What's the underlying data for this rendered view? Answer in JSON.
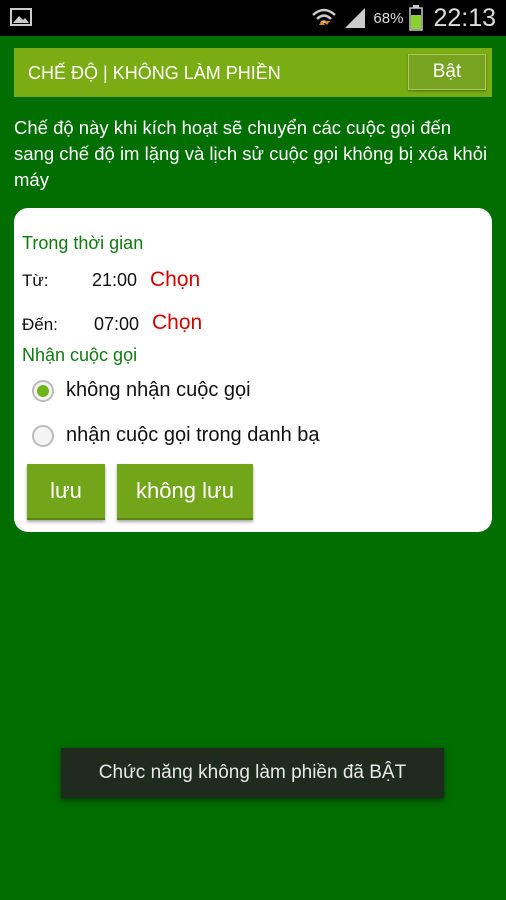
{
  "status_bar": {
    "battery_percent": "68%",
    "time": "22:13",
    "icons": [
      "image-icon",
      "wifi-icon",
      "signal-icon",
      "battery-icon"
    ]
  },
  "header": {
    "title": "CHẾ ĐỘ | KHÔNG LÀM PHIỀN",
    "toggle_label": "Bật"
  },
  "description": "Chế độ này khi kích hoạt sẽ chuyển các cuộc gọi đến sang chế độ im lặng và lịch sử cuộc gọi không bị xóa khỏi máy",
  "card": {
    "time_section_title": "Trong thời gian",
    "from": {
      "label": "Từ:",
      "time": "21:00",
      "choose_label": "Chọn"
    },
    "to": {
      "label": "Đến:",
      "time": "07:00",
      "choose_label": "Chọn"
    },
    "calls_section_title": "Nhận cuộc gọi",
    "options": [
      {
        "label": "không nhận cuộc gọi",
        "selected": true
      },
      {
        "label": "nhận cuộc gọi trong danh bạ",
        "selected": false
      }
    ],
    "save_label": "lưu",
    "dont_save_label": "không lưu"
  },
  "toast": "Chức năng không làm phiền đã BẬT",
  "colors": {
    "background": "#006e00",
    "header": "#7aac13",
    "button": "#73a51a",
    "accent_red": "#d60000",
    "section_green": "#0f7a0f"
  }
}
